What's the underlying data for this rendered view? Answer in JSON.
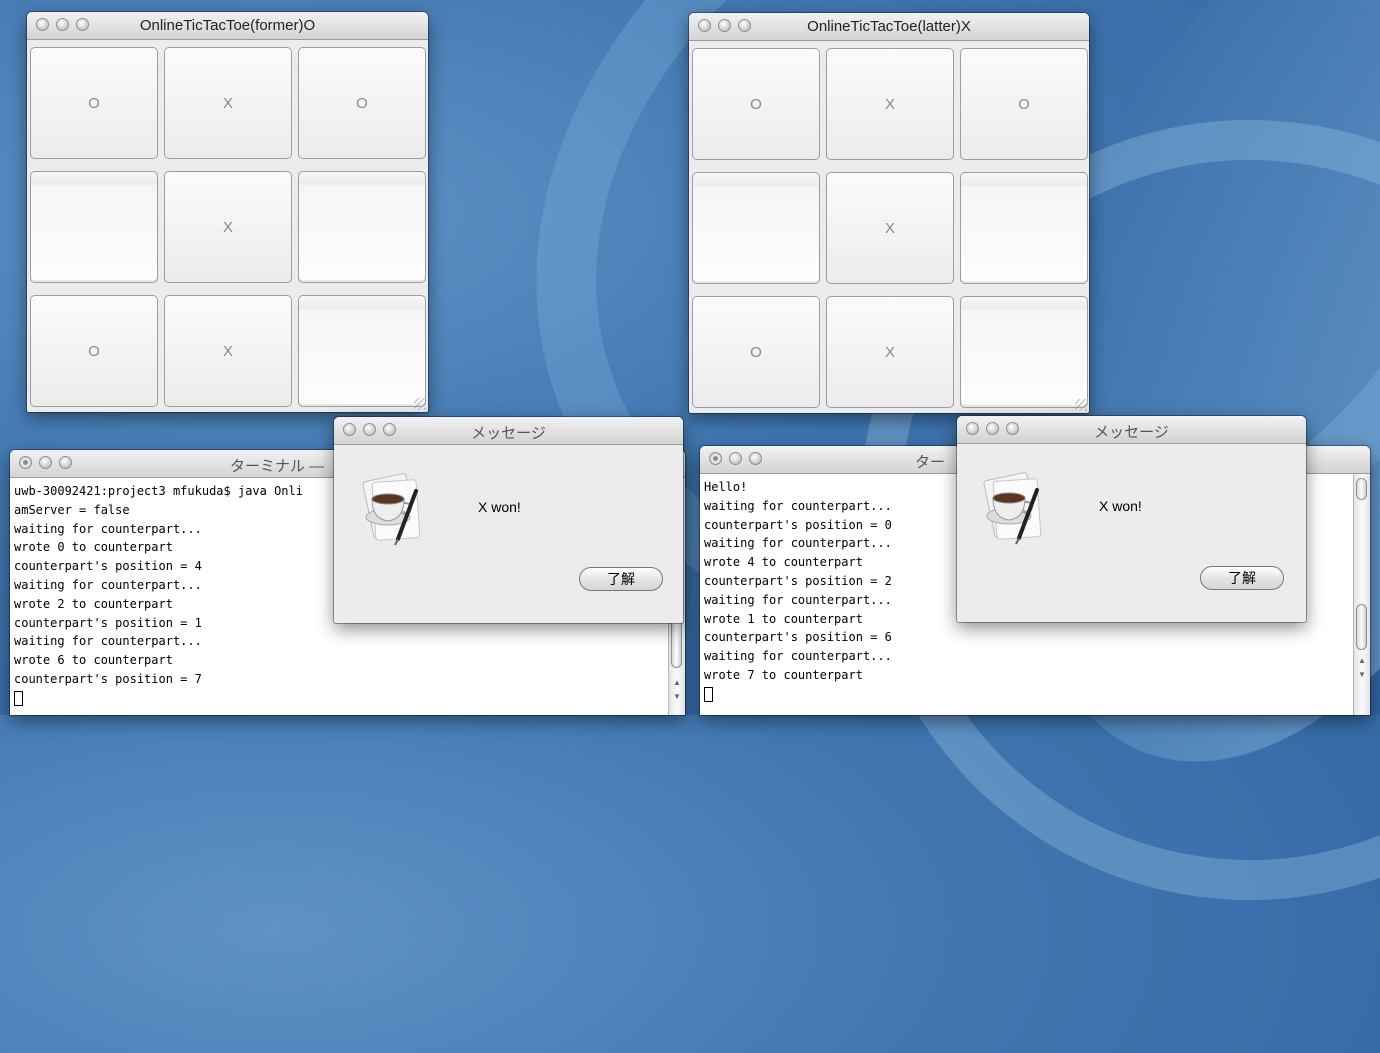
{
  "desktop": {
    "accent": "#3f76b0"
  },
  "game_windows": [
    {
      "title": "OnlineTicTacToe(former)O",
      "cells": [
        "O",
        "X",
        "O",
        "",
        "X",
        "",
        "O",
        "X",
        ""
      ]
    },
    {
      "title": "OnlineTicTacToe(latter)X",
      "cells": [
        "O",
        "X",
        "O",
        "",
        "X",
        "",
        "O",
        "X",
        ""
      ]
    }
  ],
  "terminals": [
    {
      "title": "ターミナル —",
      "lines": [
        "uwb-30092421:project3 mfukuda$ java Onli",
        "amServer = false",
        "waiting for counterpart...",
        "wrote 0 to counterpart",
        "counterpart's position = 4",
        "waiting for counterpart...",
        "wrote 2 to counterpart",
        "counterpart's position = 1",
        "waiting for counterpart...",
        "wrote 6 to counterpart",
        "counterpart's position = 7"
      ]
    },
    {
      "title": "ター",
      "lines": [
        "Hello!",
        "waiting for counterpart...",
        "counterpart's position = 0",
        "waiting for counterpart...",
        "wrote 4 to counterpart",
        "counterpart's position = 2",
        "waiting for counterpart...",
        "wrote 1 to counterpart",
        "counterpart's position = 6",
        "waiting for counterpart...",
        "wrote 7 to counterpart"
      ]
    }
  ],
  "dialogs": [
    {
      "title": "メッセージ",
      "message": "X won!",
      "button": "了解",
      "icon": "java-coffee-cup-icon"
    },
    {
      "title": "メッセージ",
      "message": "X won!",
      "button": "了解",
      "icon": "java-coffee-cup-icon"
    }
  ]
}
